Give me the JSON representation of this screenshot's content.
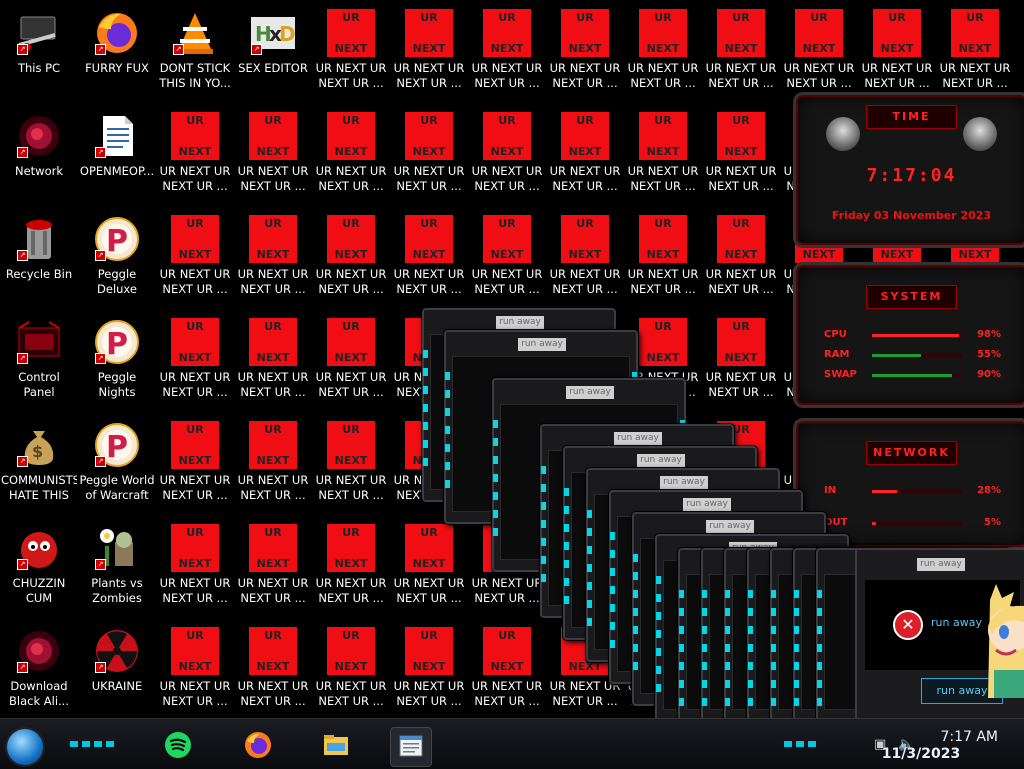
{
  "desktop": {
    "icons": [
      {
        "label": "This PC",
        "icon": "computer-icon"
      },
      {
        "label": "FURRY FUX",
        "icon": "firefox-icon"
      },
      {
        "label": "DONT STICK THIS IN YO...",
        "icon": "vlc-icon"
      },
      {
        "label": "SEX EDITOR",
        "icon": "hxd-icon"
      },
      {
        "label": "Network",
        "icon": "network-icon"
      },
      {
        "label": "OPENMEOP...",
        "icon": "document-icon"
      },
      {
        "label": "Recycle Bin",
        "icon": "recycle-bin-icon"
      },
      {
        "label": "Peggle Deluxe",
        "icon": "peggle-icon"
      },
      {
        "label": "Control Panel",
        "icon": "control-panel-icon"
      },
      {
        "label": "Peggle Nights Deluxe",
        "icon": "peggle-icon"
      },
      {
        "label": "COMMUNISTS HATE THIS G...",
        "icon": "money-bag-icon"
      },
      {
        "label": "Peggle World of Warcraft",
        "icon": "peggle-icon"
      },
      {
        "label": "CHUZZIN CUM",
        "icon": "chuzzle-icon"
      },
      {
        "label": "Plants vs Zombies",
        "icon": "plants-vs-zombies-icon"
      },
      {
        "label": "Download Black Ali...",
        "icon": "alien-icon"
      },
      {
        "label": "UKRAINE",
        "icon": "radiation-icon"
      }
    ],
    "ur_icon": {
      "top": "UR",
      "bottom": "NEXT",
      "label": "UR NEXT UR NEXT UR ..."
    }
  },
  "widget": {
    "time_title": "TIME",
    "time": "7:17:04",
    "date": "Friday 03 November 2023",
    "system_title": "SYSTEM",
    "cpu": {
      "label": "CPU",
      "value": "98%",
      "fill": 98
    },
    "ram": {
      "label": "RAM",
      "value": "55%",
      "fill": 55
    },
    "swap": {
      "label": "SWAP",
      "value": "90%",
      "fill": 90
    },
    "network_title": "NETWORK",
    "net_in": {
      "label": "IN",
      "value": "28%",
      "fill": 28
    },
    "net_out": {
      "label": "OUT",
      "value": "5%",
      "fill": 5
    }
  },
  "popup": {
    "caption": "run away",
    "message": "run away",
    "button": "run away"
  },
  "taskbar": {
    "apps": [
      "spotify-icon",
      "firefox-icon",
      "file-explorer-icon",
      "notepad-icon"
    ],
    "tray": {
      "time": "7:17 AM",
      "date": "11/3/2023"
    }
  },
  "colors": {
    "ur_red": "#f00e14",
    "accent_cyan": "#00d8e8",
    "widget_red": "#ff2222"
  }
}
